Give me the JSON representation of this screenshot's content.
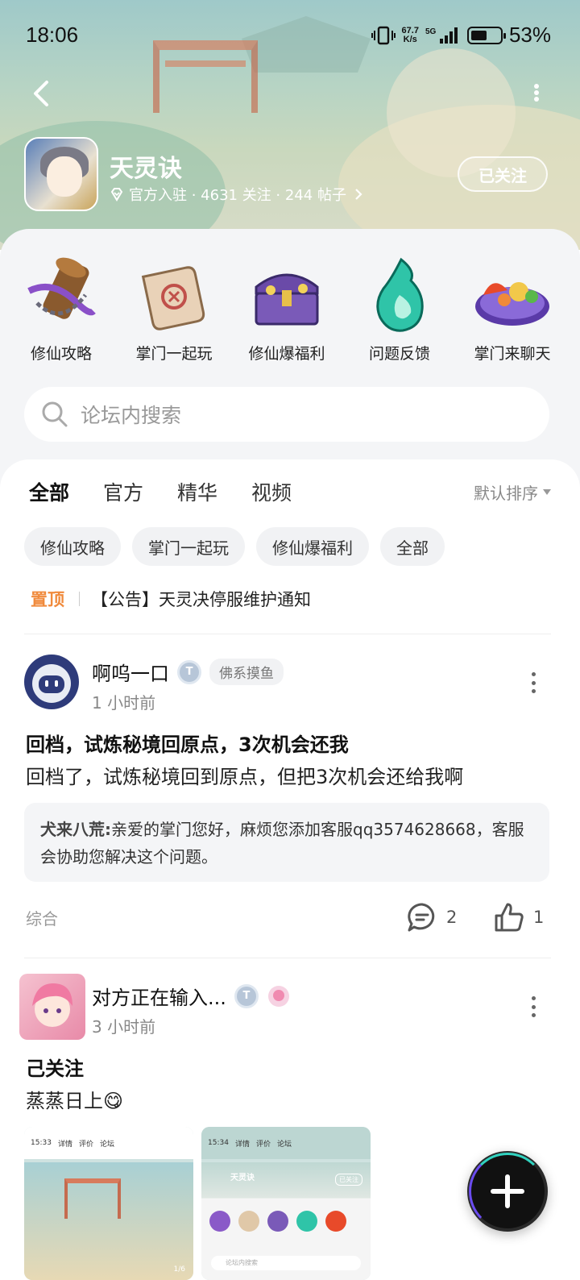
{
  "status_bar": {
    "time": "18:06",
    "net_speed_value": "67.7",
    "net_speed_unit": "K/s",
    "network": "5G",
    "battery_pct": "53%",
    "battery_level": 0.53
  },
  "header": {
    "game_title": "天灵诀",
    "meta": "官方入驻 · 4631 关注 · 244 帖子",
    "follow_label": "已关注"
  },
  "quick_entries": [
    {
      "label": "修仙攻略",
      "icon": "scroll-chain-icon"
    },
    {
      "label": "掌门一起玩",
      "icon": "paper-scroll-icon"
    },
    {
      "label": "修仙爆福利",
      "icon": "treasure-chest-icon"
    },
    {
      "label": "问题反馈",
      "icon": "green-flame-icon"
    },
    {
      "label": "掌门来聊天",
      "icon": "food-plate-icon"
    }
  ],
  "search": {
    "placeholder": "论坛内搜索"
  },
  "tabs": [
    {
      "label": "全部",
      "active": true
    },
    {
      "label": "官方",
      "active": false
    },
    {
      "label": "精华",
      "active": false
    },
    {
      "label": "视频",
      "active": false
    }
  ],
  "sort_label": "默认排序",
  "chips": [
    "修仙攻略",
    "掌门一起玩",
    "修仙爆福利",
    "全部"
  ],
  "pinned": {
    "badge": "置顶",
    "text": "【公告】天灵决停服维护通知"
  },
  "posts": [
    {
      "author": "啊呜一口",
      "tag": "佛系摸鱼",
      "time": "1 小时前",
      "title": "回档，试炼秘境回原点，3次机会还我",
      "body": "回档了，试炼秘境回到原点，但把3次机会还给我啊",
      "reply_name": "犬来八荒:",
      "reply_text": "亲爱的掌门您好，麻烦您添加客服qq3574628668，客服会协助您解决这个问题。",
      "category": "综合",
      "comments": "2",
      "likes": "1"
    },
    {
      "author": "对方正在输入...",
      "time": "3 小时前",
      "title": "己关注",
      "body": "蒸蒸日上😋",
      "thumbs": [
        {
          "time": "15:33",
          "tabs": [
            "详情",
            "评价",
            "论坛"
          ],
          "page": "1/6"
        },
        {
          "time": "15:34",
          "tabs": [
            "详情",
            "评价",
            "论坛"
          ],
          "mini_title": "天灵诀",
          "mini_follow": "已关注",
          "mini_search": "论坛内搜索"
        }
      ]
    }
  ],
  "colors": {
    "accent": "#31c6b6",
    "pinned": "#f08a3c",
    "panel_bg": "#f4f5f7"
  }
}
